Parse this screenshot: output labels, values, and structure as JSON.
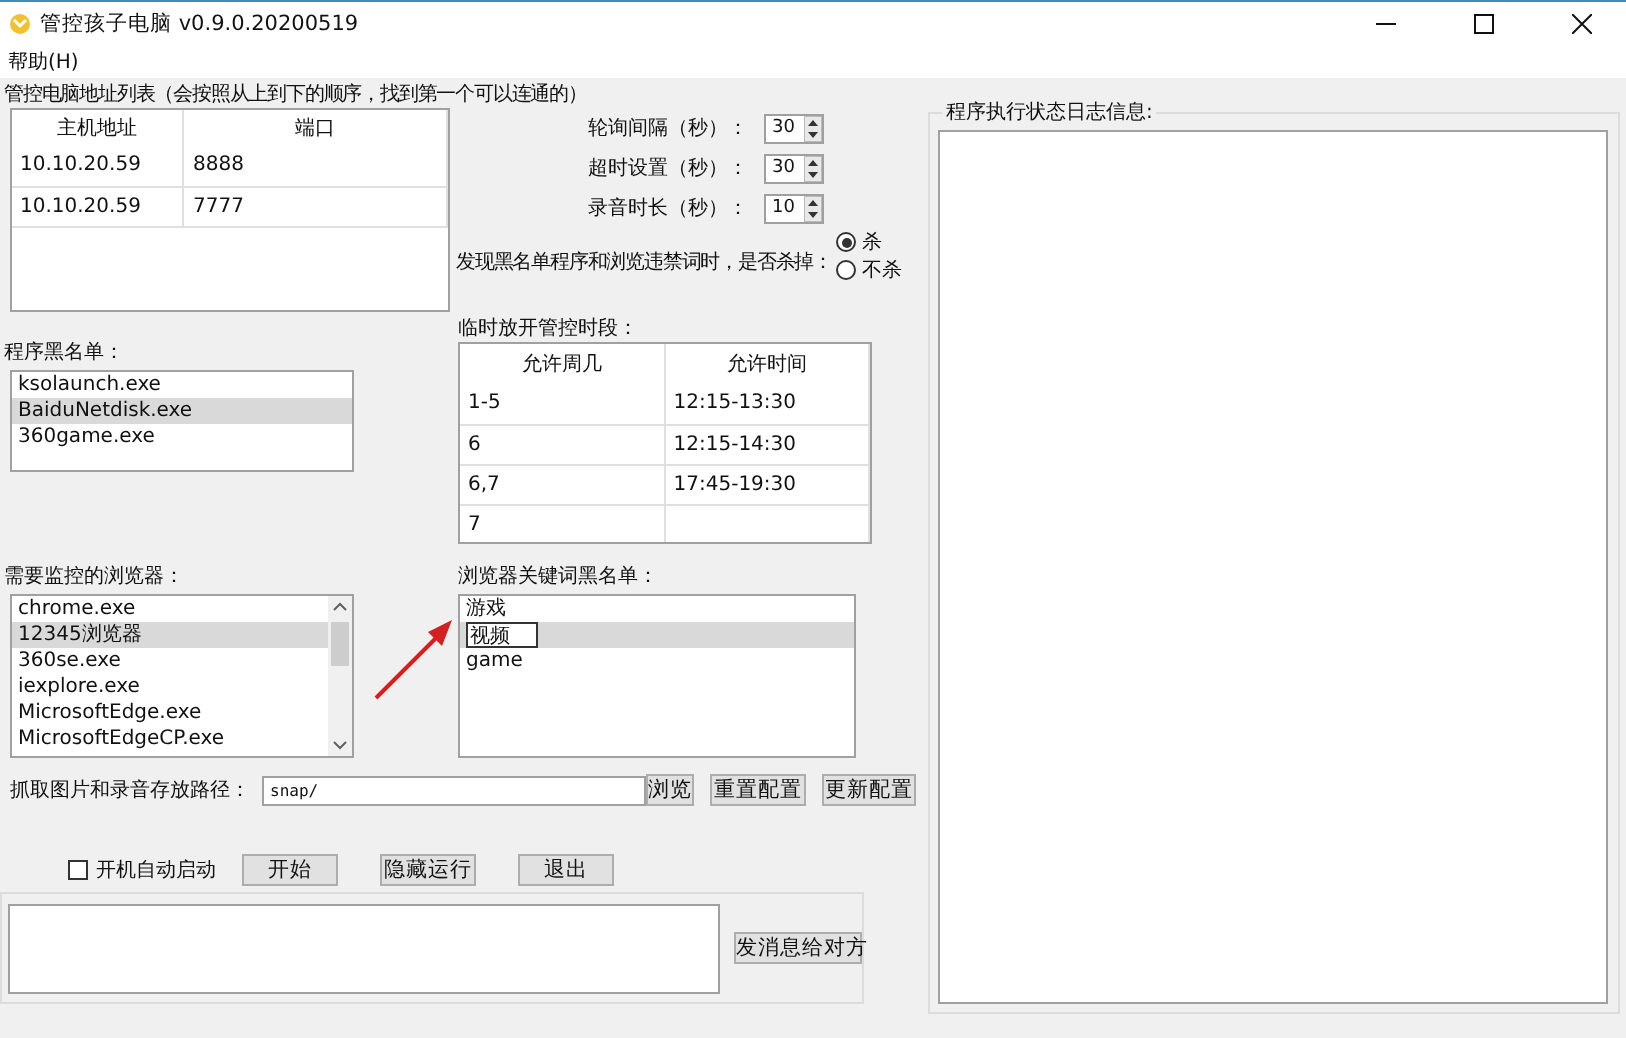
{
  "window": {
    "title": "管控孩子电脑 v0.9.0.20200519"
  },
  "menu": [
    {
      "label": "帮助(H)"
    }
  ],
  "address_list": {
    "label": "管控电脑地址列表（会按照从上到下的顺序，找到第一个可以连通的）",
    "columns": [
      "主机地址",
      "端口"
    ],
    "rows": [
      [
        "10.10.20.59",
        "8888"
      ],
      [
        "10.10.20.59",
        "7777"
      ]
    ]
  },
  "settings": [
    {
      "label": "轮询间隔（秒）：",
      "value": "30"
    },
    {
      "label": "超时设置（秒）：",
      "value": "30"
    },
    {
      "label": "录音时长（秒）：",
      "value": "10"
    }
  ],
  "kill_option": {
    "label": "发现黑名单程序和浏览违禁词时，是否杀掉：",
    "options": [
      {
        "label": "杀",
        "selected": true
      },
      {
        "label": "不杀",
        "selected": false
      }
    ]
  },
  "program_blacklist": {
    "label": "程序黑名单：",
    "items": [
      {
        "label": "ksolaunch.exe",
        "selected": false
      },
      {
        "label": "BaiduNetdisk.exe",
        "selected": true
      },
      {
        "label": "360game.exe",
        "selected": false
      }
    ]
  },
  "schedule": {
    "label": "临时放开管控时段：",
    "columns": [
      "允许周几",
      "允许时间"
    ],
    "rows": [
      [
        "1-5",
        "12:15-13:30"
      ],
      [
        "6",
        "12:15-14:30"
      ],
      [
        "6,7",
        "17:45-19:30"
      ],
      [
        "7"
      ]
    ]
  },
  "browsers": {
    "label": "需要监控的浏览器：",
    "items": [
      {
        "label": "chrome.exe",
        "selected": false
      },
      {
        "label": "12345浏览器",
        "selected": true
      },
      {
        "label": "360se.exe",
        "selected": false
      },
      {
        "label": "iexplore.exe",
        "selected": false
      },
      {
        "label": "MicrosoftEdge.exe",
        "selected": false
      },
      {
        "label": "MicrosoftEdgeCP.exe",
        "selected": false
      }
    ]
  },
  "keywords": {
    "label": "浏览器关键词黑名单：",
    "items": [
      {
        "label": "游戏",
        "selected": false,
        "editing": false
      },
      {
        "label": "视频",
        "selected": true,
        "editing": true
      },
      {
        "label": "game",
        "selected": false,
        "editing": false
      }
    ]
  },
  "path": {
    "label": "抓取图片和录音存放路径：",
    "value": "snap/",
    "buttons": [
      "浏览",
      "重置配置",
      "更新配置"
    ]
  },
  "autostart": {
    "label": "开机自动启动",
    "checked": false
  },
  "actions": [
    "开始",
    "隐藏运行",
    "退出"
  ],
  "message": {
    "button": "发消息给对方"
  },
  "log": {
    "label": "程序执行状态日志信息:"
  }
}
